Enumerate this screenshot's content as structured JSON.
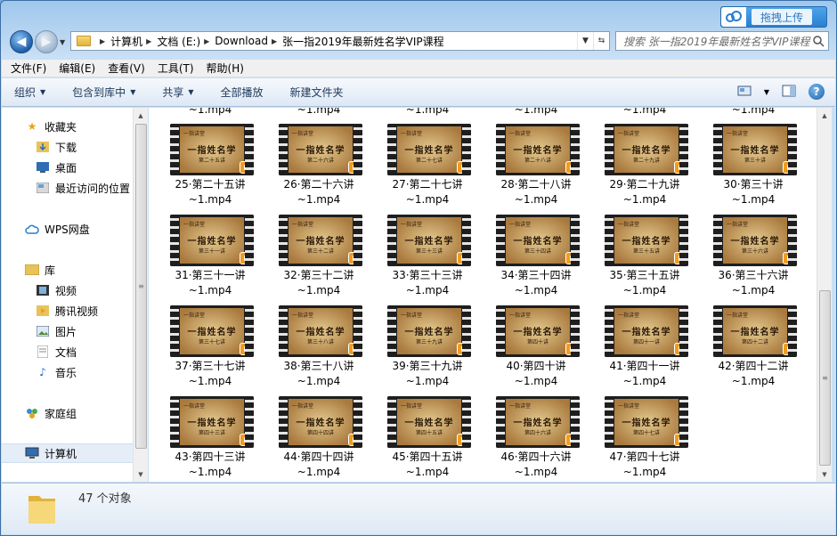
{
  "address": {
    "crumbs": [
      "计算机",
      "文档 (E:)",
      "Download",
      "张一指2019年最新姓名学VIP课程"
    ]
  },
  "search": {
    "placeholder": "搜索 张一指2019年最新姓名学VIP课程"
  },
  "upload": {
    "label": "拖拽上传"
  },
  "menu": [
    "文件(F)",
    "编辑(E)",
    "查看(V)",
    "工具(T)",
    "帮助(H)"
  ],
  "commands": {
    "organize": "组织",
    "include": "包含到库中",
    "share": "共享",
    "play_all": "全部播放",
    "new_folder": "新建文件夹"
  },
  "nav": {
    "favorites": "收藏夹",
    "downloads": "下载",
    "desktop": "桌面",
    "recent": "最近访问的位置",
    "wps": "WPS网盘",
    "library": "库",
    "videos": "视频",
    "tencent_video": "腾讯视频",
    "pictures": "图片",
    "documents": "文档",
    "music": "音乐",
    "homegroup": "家庭组",
    "computer": "计算机"
  },
  "thumb_text": {
    "header": "一指讲堂",
    "title": "一指姓名学"
  },
  "partial_row": [
    "~1.mp4",
    "~1.mp4",
    "~1.mp4",
    "~1.mp4",
    "~1.mp4",
    "~1.mp4"
  ],
  "files": [
    {
      "line1": "25·第二十五讲",
      "line2": "~1.mp4",
      "sub": "第二十五讲"
    },
    {
      "line1": "26·第二十六讲",
      "line2": "~1.mp4",
      "sub": "第二十六讲"
    },
    {
      "line1": "27·第二十七讲",
      "line2": "~1.mp4",
      "sub": "第二十七讲"
    },
    {
      "line1": "28·第二十八讲",
      "line2": "~1.mp4",
      "sub": "第二十八讲"
    },
    {
      "line1": "29·第二十九讲",
      "line2": "~1.mp4",
      "sub": "第二十九讲"
    },
    {
      "line1": "30·第三十讲",
      "line2": "~1.mp4",
      "sub": "第三十讲"
    },
    {
      "line1": "31·第三十一讲",
      "line2": "~1.mp4",
      "sub": "第三十一讲"
    },
    {
      "line1": "32·第三十二讲",
      "line2": "~1.mp4",
      "sub": "第三十二讲"
    },
    {
      "line1": "33·第三十三讲",
      "line2": "~1.mp4",
      "sub": "第三十三讲"
    },
    {
      "line1": "34·第三十四讲",
      "line2": "~1.mp4",
      "sub": "第三十四讲"
    },
    {
      "line1": "35·第三十五讲",
      "line2": "~1.mp4",
      "sub": "第三十五讲"
    },
    {
      "line1": "36·第三十六讲",
      "line2": "~1.mp4",
      "sub": "第三十六讲"
    },
    {
      "line1": "37·第三十七讲",
      "line2": "~1.mp4",
      "sub": "第三十七讲"
    },
    {
      "line1": "38·第三十八讲",
      "line2": "~1.mp4",
      "sub": "第三十八讲"
    },
    {
      "line1": "39·第三十九讲",
      "line2": "~1.mp4",
      "sub": "第三十九讲"
    },
    {
      "line1": "40·第四十讲",
      "line2": "~1.mp4",
      "sub": "第四十讲"
    },
    {
      "line1": "41·第四十一讲",
      "line2": "~1.mp4",
      "sub": "第四十一讲"
    },
    {
      "line1": "42·第四十二讲",
      "line2": "~1.mp4",
      "sub": "第四十二讲"
    },
    {
      "line1": "43·第四十三讲",
      "line2": "~1.mp4",
      "sub": "第四十三讲"
    },
    {
      "line1": "44·第四十四讲",
      "line2": "~1.mp4",
      "sub": "第四十四讲"
    },
    {
      "line1": "45·第四十五讲",
      "line2": "~1.mp4",
      "sub": "第四十五讲"
    },
    {
      "line1": "46·第四十六讲",
      "line2": "~1.mp4",
      "sub": "第四十六讲"
    },
    {
      "line1": "47·第四十七讲",
      "line2": "~1.mp4",
      "sub": "第四十七讲"
    }
  ],
  "status": {
    "count": "47 个对象"
  },
  "colors": {
    "accent": "#2a7fd0",
    "play": "#f29b1e",
    "selected": "#e5eef8"
  }
}
